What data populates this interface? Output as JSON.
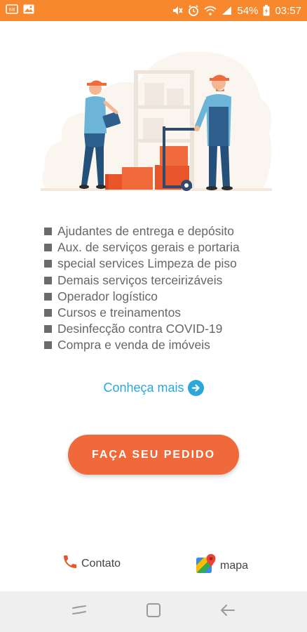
{
  "status_bar": {
    "battery": "54%",
    "time": "03:57"
  },
  "colors": {
    "status_bar": "#f7882e",
    "accent_orange": "#f0693a",
    "link_blue": "#2ba7dc",
    "bullet_gray": "#6b6b6b",
    "nav_bar": "#efefef"
  },
  "services": [
    "Ajudantes de entrega e depósito",
    "Aux. de serviços gerais e portaria",
    "special services Limpeza de piso",
    "Demais serviços terceirizáveis",
    "Operador logístico",
    "Cursos e treinamentos",
    "Desinfecção contra COVID-19",
    "Compra e venda de imóveis"
  ],
  "learn_more_label": "Conheça mais",
  "order_button_label": "FAÇA SEU PEDIDO",
  "footer": {
    "contact_label": "Contato",
    "map_label": "mapa"
  },
  "icons": {
    "status_left": [
      "gallery-icon",
      "image-icon"
    ],
    "status_right": [
      "mute-icon",
      "alarm-icon",
      "wifi-icon",
      "signal-icon",
      "battery-icon"
    ],
    "learn_more": "arrow-right-circle-icon",
    "contact": "phone-icon",
    "map": "google-maps-icon",
    "nav": [
      "recent-apps-icon",
      "home-icon",
      "back-icon"
    ]
  }
}
